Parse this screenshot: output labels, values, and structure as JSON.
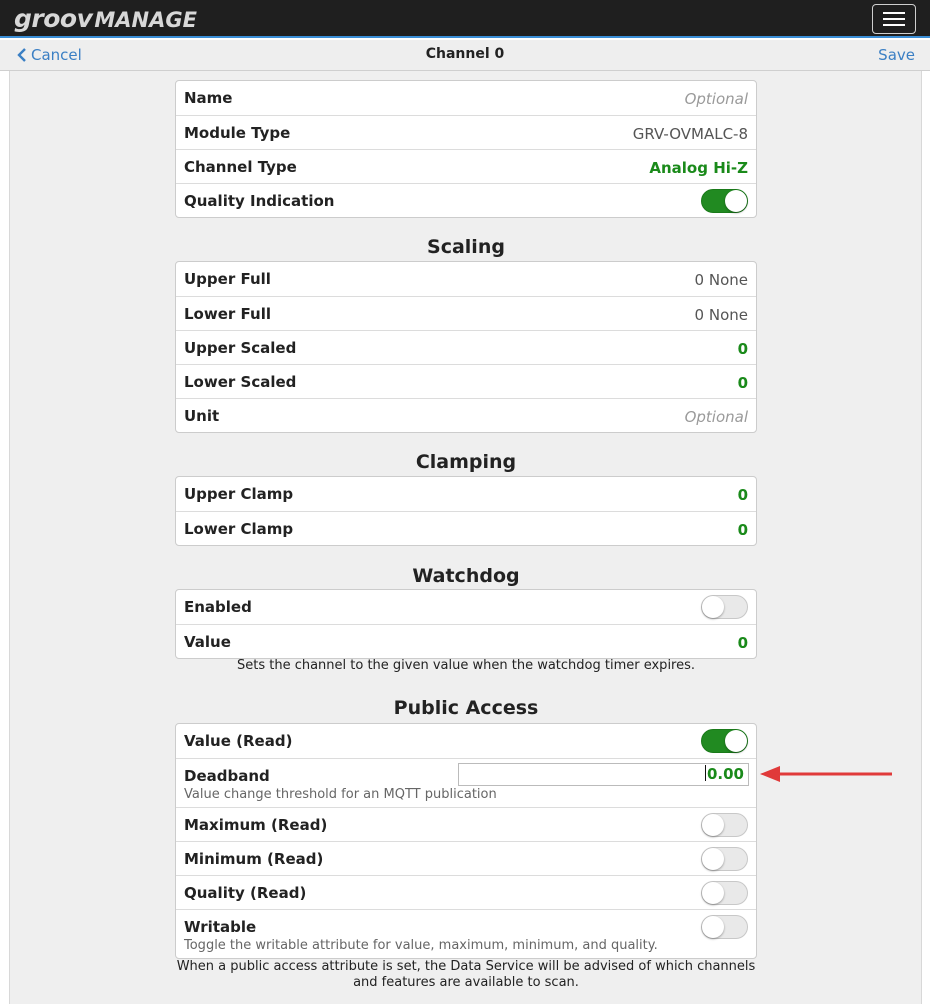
{
  "header": {
    "logo_part1": "groov",
    "logo_part2": "MANAGE"
  },
  "nav": {
    "cancel_label": "Cancel",
    "title": "Channel 0",
    "save_label": "Save"
  },
  "general": {
    "name_label": "Name",
    "name_placeholder": "Optional",
    "module_type_label": "Module Type",
    "module_type_value": "GRV-OVMALC-8",
    "channel_type_label": "Channel Type",
    "channel_type_value": "Analog Hi-Z",
    "quality_label": "Quality Indication",
    "quality_on": true
  },
  "scaling": {
    "title": "Scaling",
    "upper_full_label": "Upper Full",
    "upper_full_value": "0 None",
    "lower_full_label": "Lower Full",
    "lower_full_value": "0 None",
    "upper_scaled_label": "Upper Scaled",
    "upper_scaled_value": "0",
    "lower_scaled_label": "Lower Scaled",
    "lower_scaled_value": "0",
    "unit_label": "Unit",
    "unit_placeholder": "Optional"
  },
  "clamping": {
    "title": "Clamping",
    "upper_label": "Upper Clamp",
    "upper_value": "0",
    "lower_label": "Lower Clamp",
    "lower_value": "0"
  },
  "watchdog": {
    "title": "Watchdog",
    "enabled_label": "Enabled",
    "enabled_on": false,
    "value_label": "Value",
    "value": "0",
    "help": "Sets the channel to the given value when the watchdog timer expires."
  },
  "public_access": {
    "title": "Public Access",
    "value_read_label": "Value (Read)",
    "value_read_on": true,
    "deadband_label": "Deadband",
    "deadband_value": "0.00",
    "deadband_help": "Value change threshold for an MQTT publication",
    "maximum_label": "Maximum (Read)",
    "maximum_on": false,
    "minimum_label": "Minimum (Read)",
    "minimum_on": false,
    "quality_label": "Quality (Read)",
    "quality_on": false,
    "writable_label": "Writable",
    "writable_on": false,
    "writable_help": "Toggle the writable attribute for value, maximum, minimum, and quality.",
    "footer_help": "When a public access attribute is set, the Data Service will be advised of which channels and features are available to scan."
  },
  "colors": {
    "accent_blue": "#3a7fc4",
    "value_green": "#1a8a1a",
    "toggle_on": "#218a21",
    "annotation_arrow": "#e03a3a"
  }
}
